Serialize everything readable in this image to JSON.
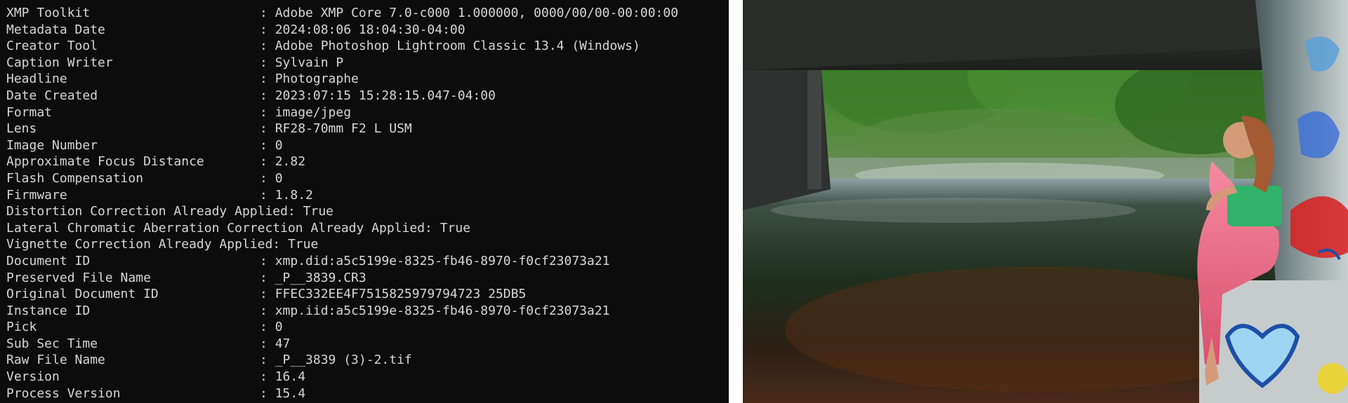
{
  "terminal": {
    "background": "#0c0c0c",
    "text_color": "#d6d6d6",
    "rows": [
      {
        "key": "XMP Toolkit",
        "sep": ": ",
        "value": "Adobe XMP Core 7.0-c000 1.000000, 0000/00/00-00:00:00",
        "aligned": true
      },
      {
        "key": "Metadata Date",
        "sep": ": ",
        "value": "2024:08:06 18:04:30-04:00",
        "aligned": true
      },
      {
        "key": "Creator Tool",
        "sep": ": ",
        "value": "Adobe Photoshop Lightroom Classic 13.4 (Windows)",
        "aligned": true
      },
      {
        "key": "Caption Writer",
        "sep": ": ",
        "value": "Sylvain P",
        "aligned": true
      },
      {
        "key": "Headline",
        "sep": ": ",
        "value": "Photographe",
        "aligned": true
      },
      {
        "key": "Date Created",
        "sep": ": ",
        "value": "2023:07:15 15:28:15.047-04:00",
        "aligned": true
      },
      {
        "key": "Format",
        "sep": ": ",
        "value": "image/jpeg",
        "aligned": true
      },
      {
        "key": "Lens",
        "sep": ": ",
        "value": "RF28-70mm F2 L USM",
        "aligned": true
      },
      {
        "key": "Image Number",
        "sep": ": ",
        "value": "0",
        "aligned": true
      },
      {
        "key": "Approximate Focus Distance",
        "sep": ": ",
        "value": "2.82",
        "aligned": true
      },
      {
        "key": "Flash Compensation",
        "sep": ": ",
        "value": "0",
        "aligned": true
      },
      {
        "key": "Firmware",
        "sep": ": ",
        "value": "1.8.2",
        "aligned": true
      },
      {
        "key": "Distortion Correction Already Applied",
        "sep": ": ",
        "value": "True",
        "aligned": false
      },
      {
        "key": "Lateral Chromatic Aberration Correction Already Applied",
        "sep": ": ",
        "value": "True",
        "aligned": false
      },
      {
        "key": "Vignette Correction Already Applied",
        "sep": ": ",
        "value": "True",
        "aligned": false
      },
      {
        "key": "Document ID",
        "sep": ": ",
        "value": "xmp.did:a5c5199e-8325-fb46-8970-f0cf23073a21",
        "aligned": true
      },
      {
        "key": "Preserved File Name",
        "sep": ": ",
        "value": "_P__3839.CR3",
        "aligned": true
      },
      {
        "key": "Original Document ID",
        "sep": ": ",
        "value": "FFEC332EE4F7515825979794723 25DB5",
        "aligned": true
      },
      {
        "key": "Instance ID",
        "sep": ": ",
        "value": "xmp.iid:a5c5199e-8325-fb46-8970-f0cf23073a21",
        "aligned": true
      },
      {
        "key": "Pick",
        "sep": ": ",
        "value": "0",
        "aligned": true
      },
      {
        "key": "Sub Sec Time",
        "sep": ": ",
        "value": "47",
        "aligned": true
      },
      {
        "key": "Raw File Name",
        "sep": ": ",
        "value": "_P__3839 (3)-2.tif",
        "aligned": true
      },
      {
        "key": "Version",
        "sep": ": ",
        "value": "16.4",
        "aligned": true
      },
      {
        "key": "Process Version",
        "sep": ": ",
        "value": "15.4",
        "aligned": true
      }
    ]
  },
  "photo": {
    "subject": "woman-sitting-under-bridge-by-river",
    "colors": {
      "forest": "#3f7a2c",
      "water": "#1c2a1c",
      "concrete": "#3a3a37",
      "top_green": "#2fb36a",
      "skirt_pink": "#f07088",
      "graffiti_red": "#d81e1e",
      "graffiti_blue": "#3a6fd8"
    }
  }
}
